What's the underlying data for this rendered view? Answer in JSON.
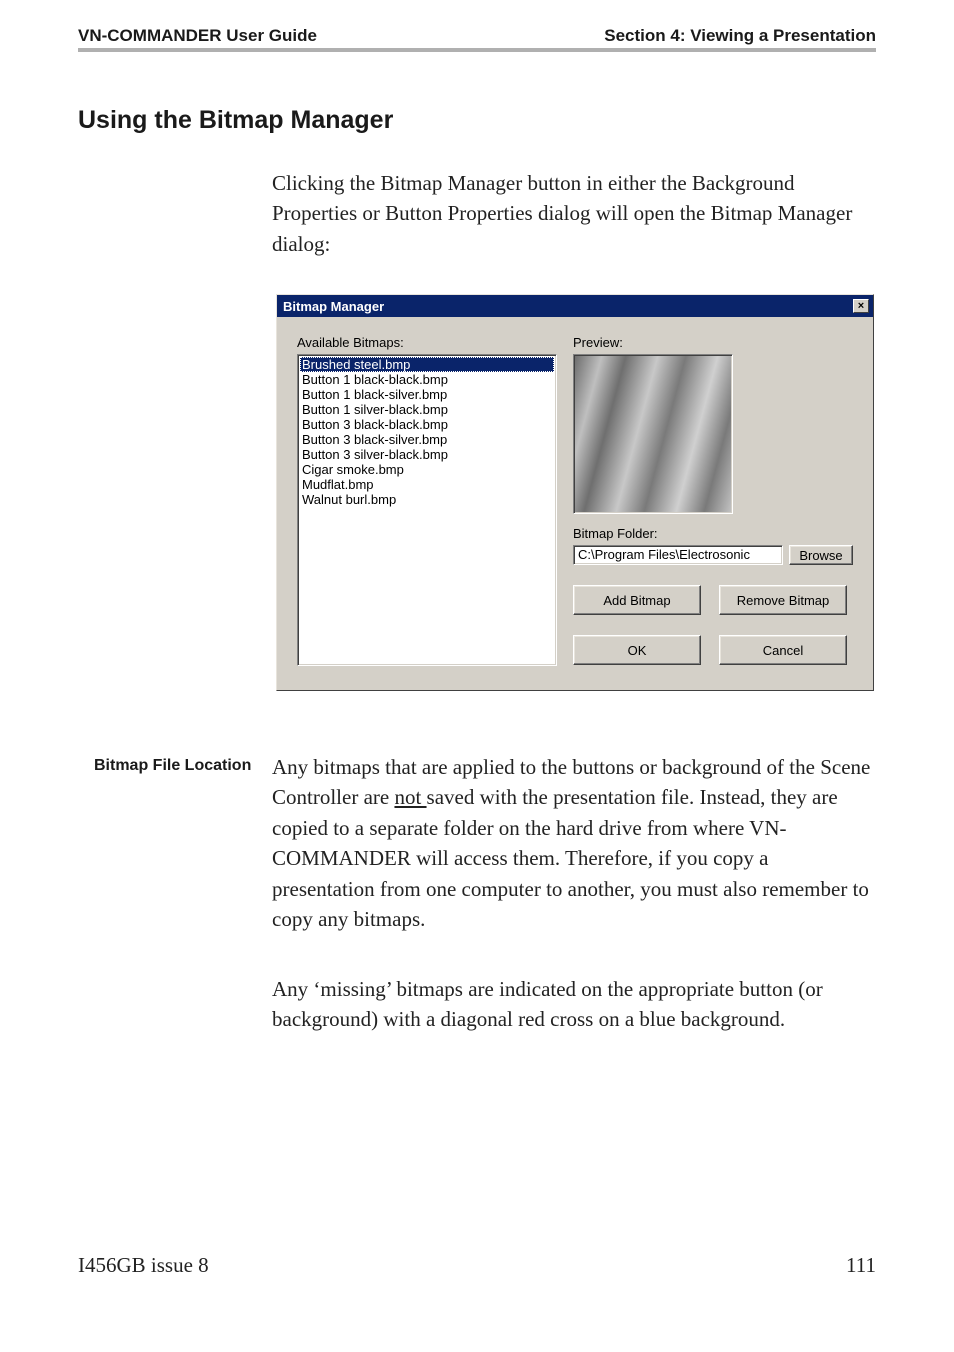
{
  "header": {
    "left": "VN-COMMANDER User Guide",
    "right": "Section 4: Viewing a Presentation"
  },
  "page_title": "Using the Bitmap Manager",
  "intro_text": "Clicking the Bitmap Manager button in either the Background Properties or Button Properties dialog will open the Bitmap Manager dialog:",
  "dialog": {
    "title": "Bitmap Manager",
    "close_glyph": "×",
    "available_label": "Available Bitmaps:",
    "list_items": [
      "Brushed steel.bmp",
      "Button 1 black-black.bmp",
      "Button 1 black-silver.bmp",
      "Button 1 silver-black.bmp",
      "Button 3 black-black.bmp",
      "Button 3 black-silver.bmp",
      "Button 3 silver-black.bmp",
      "Cigar smoke.bmp",
      "Mudflat.bmp",
      "Walnut burl.bmp"
    ],
    "selected_index": 0,
    "preview_label": "Preview:",
    "folder_label": "Bitmap Folder:",
    "folder_value": "C:\\Program Files\\Electrosonic",
    "browse_label": "Browse",
    "add_label": "Add Bitmap",
    "remove_label": "Remove Bitmap",
    "ok_label": "OK",
    "cancel_label": "Cancel"
  },
  "section_label": "Bitmap File Location",
  "para1_pre": "Any bitmaps that are applied to the buttons or background of the Scene Controller are ",
  "para1_underlined": "not ",
  "para1_post": "saved with the presentation file. Instead, they are copied to a separate folder on the hard drive from where VN-COMMANDER will access them. Therefore, if you copy a presentation from one computer to another, you must also remember to copy any bitmaps.",
  "para2": "Any ‘missing’ bitmaps are indicated on the appropriate button (or background) with a diagonal red cross on a blue background.",
  "footer": {
    "left": "I456GB issue 8",
    "right": "111"
  }
}
